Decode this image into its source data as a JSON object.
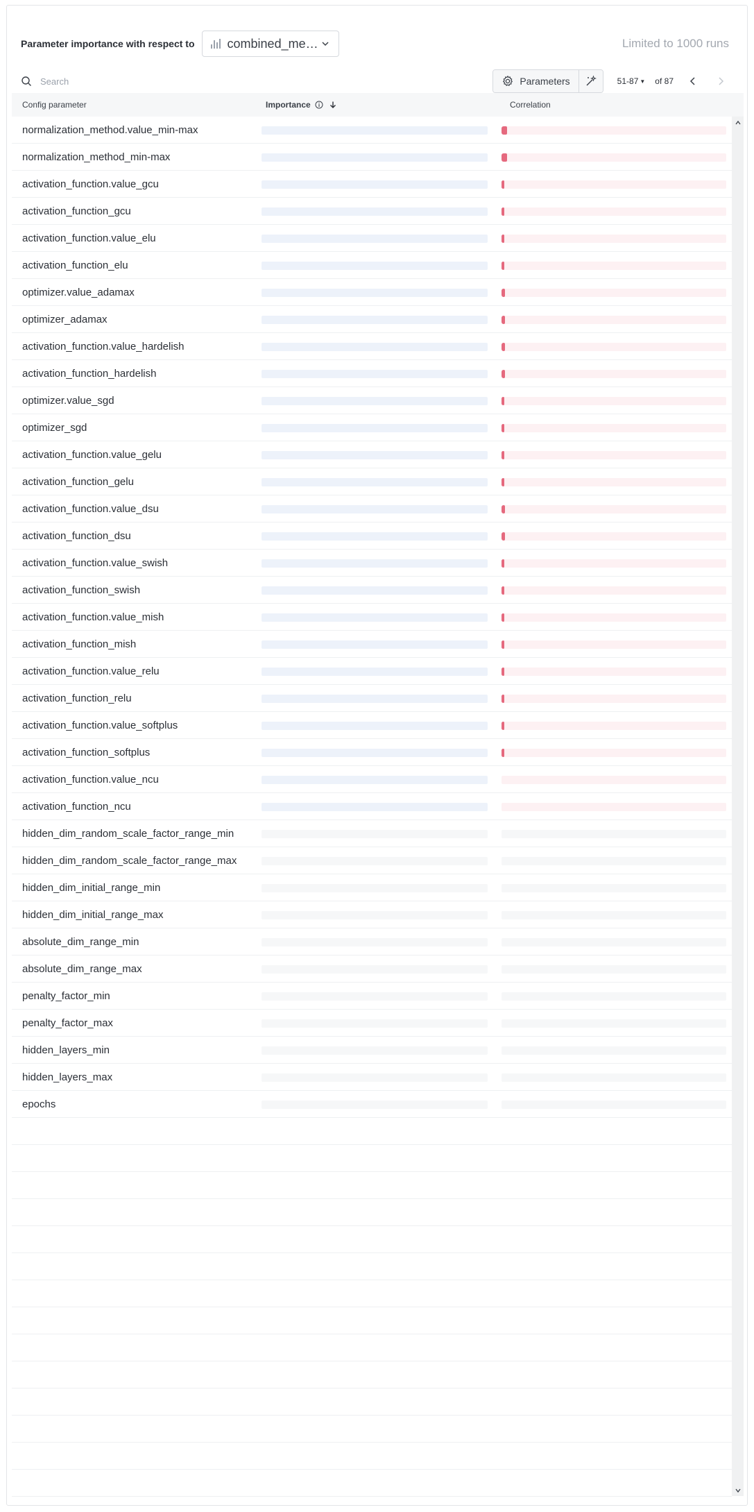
{
  "header": {
    "label": "Parameter importance with respect to",
    "metric": "combined_me…",
    "limit_text": "Limited to 1000 runs"
  },
  "toolbar": {
    "search_placeholder": "Search",
    "parameters_label": "Parameters",
    "page_range": "51-87",
    "page_total": "of 87"
  },
  "table": {
    "columns": {
      "config": "Config parameter",
      "importance": "Importance",
      "correlation": "Correlation"
    },
    "rows": [
      {
        "name": "normalization_method.value_min-max",
        "correlation": 0.025,
        "active": true
      },
      {
        "name": "normalization_method_min-max",
        "correlation": 0.025,
        "active": true
      },
      {
        "name": "activation_function.value_gcu",
        "correlation": 0.012,
        "active": true
      },
      {
        "name": "activation_function_gcu",
        "correlation": 0.012,
        "active": true
      },
      {
        "name": "activation_function.value_elu",
        "correlation": 0.013,
        "active": true
      },
      {
        "name": "activation_function_elu",
        "correlation": 0.013,
        "active": true
      },
      {
        "name": "optimizer.value_adamax",
        "correlation": 0.016,
        "active": true
      },
      {
        "name": "optimizer_adamax",
        "correlation": 0.016,
        "active": true
      },
      {
        "name": "activation_function.value_hardelish",
        "correlation": 0.014,
        "active": true
      },
      {
        "name": "activation_function_hardelish",
        "correlation": 0.014,
        "active": true
      },
      {
        "name": "optimizer.value_sgd",
        "correlation": 0.011,
        "active": true
      },
      {
        "name": "optimizer_sgd",
        "correlation": 0.011,
        "active": true
      },
      {
        "name": "activation_function.value_gelu",
        "correlation": 0.013,
        "active": true
      },
      {
        "name": "activation_function_gelu",
        "correlation": 0.013,
        "active": true
      },
      {
        "name": "activation_function.value_dsu",
        "correlation": 0.016,
        "active": true
      },
      {
        "name": "activation_function_dsu",
        "correlation": 0.016,
        "active": true
      },
      {
        "name": "activation_function.value_swish",
        "correlation": 0.012,
        "active": true
      },
      {
        "name": "activation_function_swish",
        "correlation": 0.012,
        "active": true
      },
      {
        "name": "activation_function.value_mish",
        "correlation": 0.012,
        "active": true
      },
      {
        "name": "activation_function_mish",
        "correlation": 0.012,
        "active": true
      },
      {
        "name": "activation_function.value_relu",
        "correlation": 0.011,
        "active": true
      },
      {
        "name": "activation_function_relu",
        "correlation": 0.011,
        "active": true
      },
      {
        "name": "activation_function.value_softplus",
        "correlation": 0.012,
        "active": true
      },
      {
        "name": "activation_function_softplus",
        "correlation": 0.012,
        "active": true
      },
      {
        "name": "activation_function.value_ncu",
        "correlation": 0,
        "active": true
      },
      {
        "name": "activation_function_ncu",
        "correlation": 0,
        "active": true
      },
      {
        "name": "hidden_dim_random_scale_factor_range_min",
        "correlation": 0,
        "active": false
      },
      {
        "name": "hidden_dim_random_scale_factor_range_max",
        "correlation": 0,
        "active": false
      },
      {
        "name": "hidden_dim_initial_range_min",
        "correlation": 0,
        "active": false
      },
      {
        "name": "hidden_dim_initial_range_max",
        "correlation": 0,
        "active": false
      },
      {
        "name": "absolute_dim_range_min",
        "correlation": 0,
        "active": false
      },
      {
        "name": "absolute_dim_range_max",
        "correlation": 0,
        "active": false
      },
      {
        "name": "penalty_factor_min",
        "correlation": 0,
        "active": false
      },
      {
        "name": "penalty_factor_max",
        "correlation": 0,
        "active": false
      },
      {
        "name": "hidden_layers_min",
        "correlation": 0,
        "active": false
      },
      {
        "name": "hidden_layers_max",
        "correlation": 0,
        "active": false
      },
      {
        "name": "epochs",
        "correlation": 0,
        "active": false
      }
    ]
  },
  "colors": {
    "importance_track": "#edf2fa",
    "correlation_track": "#fdf1f3",
    "correlation_fill": "#e5697e",
    "inactive_track": "#f6f7f8"
  }
}
